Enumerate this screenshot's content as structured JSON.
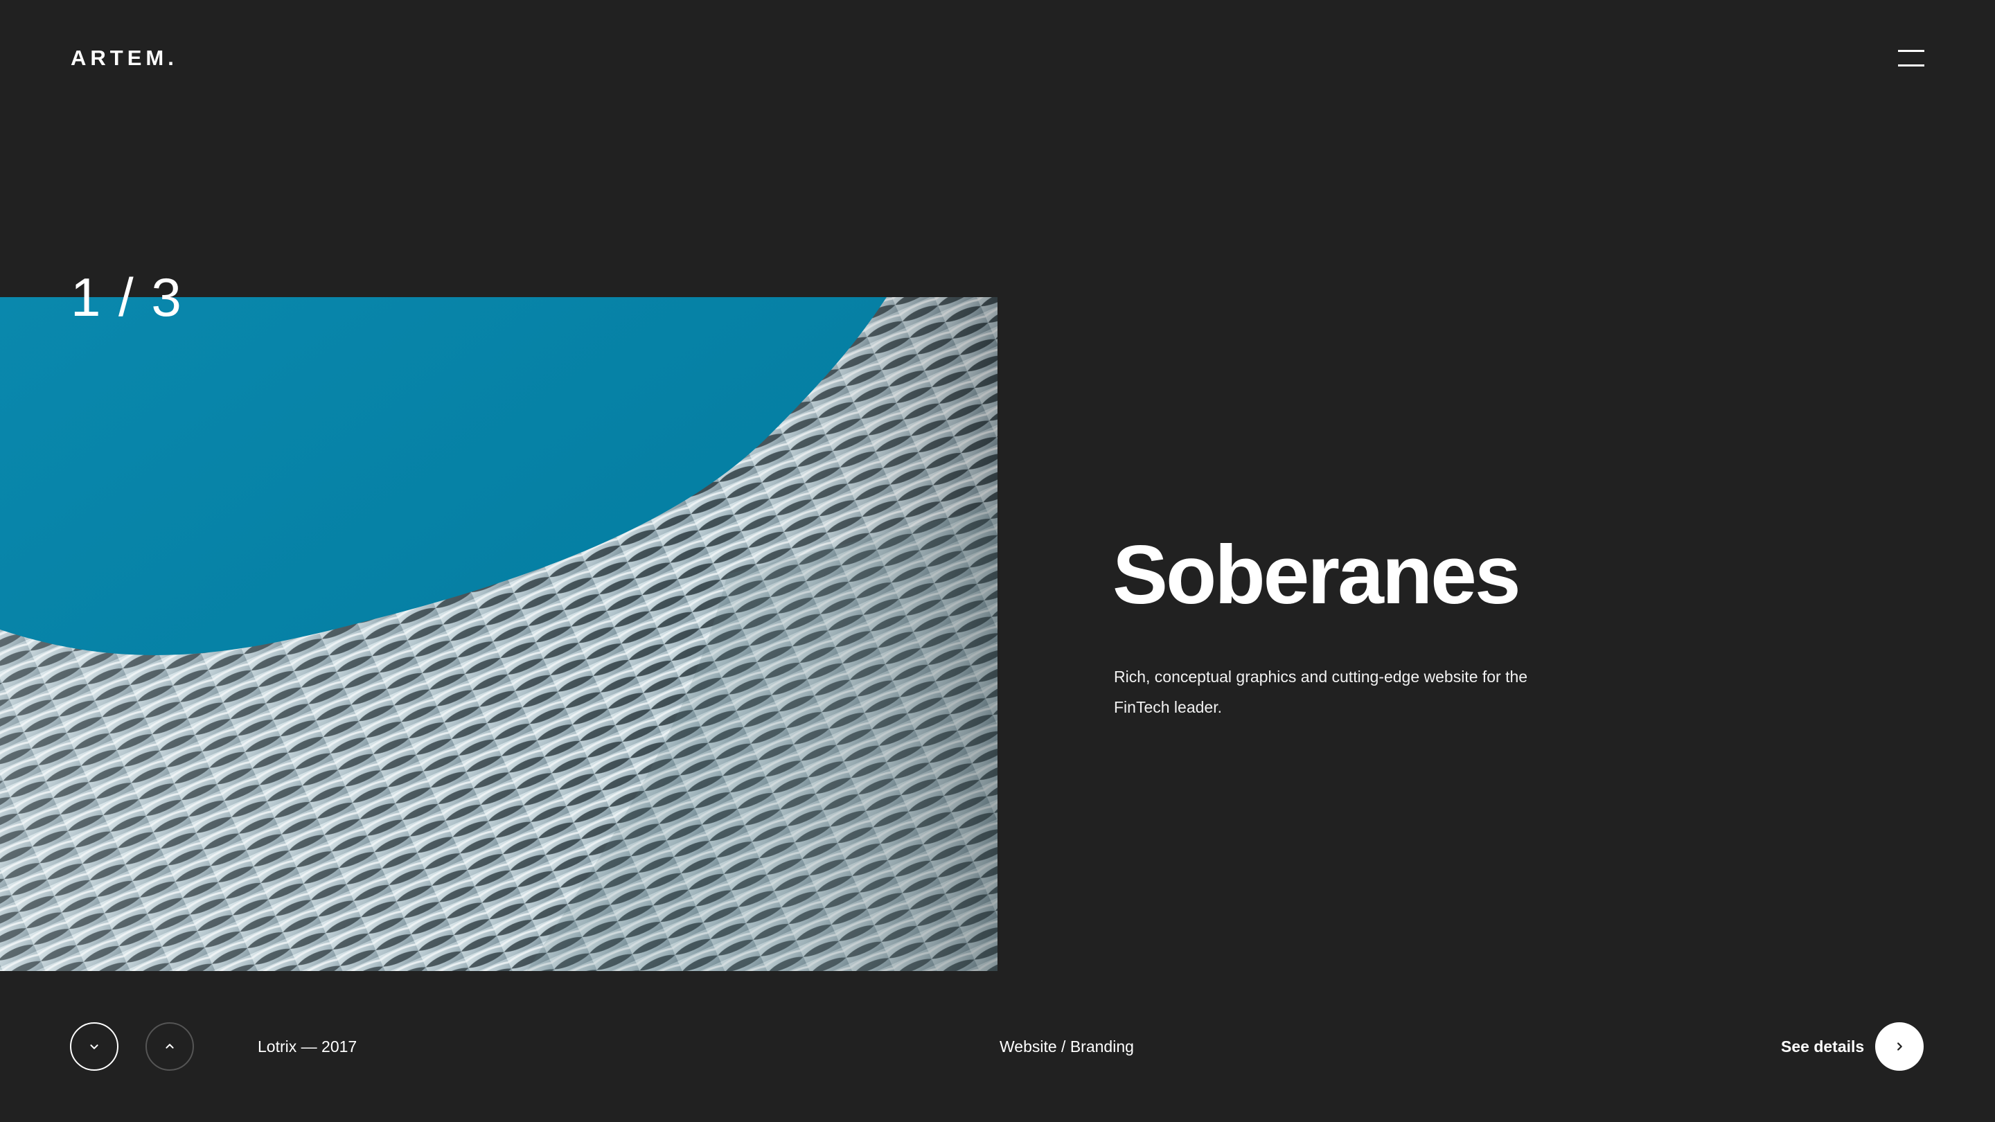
{
  "header": {
    "logo": "ARTEM.",
    "menu_icon": "hamburger-menu-icon"
  },
  "slide": {
    "counter": "1 / 3",
    "title": "Soberanes",
    "description": "Rich, conceptual graphics and cutting-edge website for the FinTech leader."
  },
  "footer": {
    "prev_icon": "chevron-down-icon",
    "next_icon": "chevron-up-icon",
    "client_year": "Lotrix — 2017",
    "category": "Website / Branding",
    "details_label": "See details",
    "details_icon": "chevron-right-icon"
  },
  "colors": {
    "background": "#212121",
    "sky": "#027ea1",
    "text": "#ffffff"
  }
}
